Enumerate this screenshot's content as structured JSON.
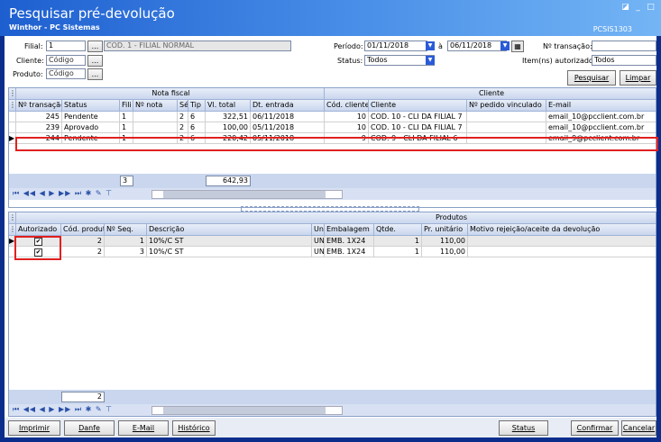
{
  "window": {
    "title": "Pesquisar pré-devolução",
    "subtitle": "Winthor - PC Sistemas",
    "code": "PCSIS1303"
  },
  "filters": {
    "filial_label": "Filial:",
    "filial_value": "1",
    "filial_desc": "COD. 1 - FILIAL NORMAL",
    "cliente_label": "Cliente:",
    "cliente_placeholder": "Código",
    "produto_label": "Produto:",
    "produto_placeholder": "Código",
    "periodo_label": "Período:",
    "periodo_start": "01/11/2018",
    "periodo_sep": "à",
    "periodo_end": "06/11/2018",
    "status_label": "Status:",
    "status_value": "Todos",
    "transacao_label": "Nº transação:",
    "transacao_value": "",
    "itens_label": "Item(ns) autorizado:",
    "itens_value": "Todos",
    "ellipsis": "..."
  },
  "actions": {
    "pesquisar": "Pesquisar",
    "limpar": "Limpar"
  },
  "grid1": {
    "group_nota": "Nota fiscal",
    "group_cliente": "Cliente",
    "headers": [
      "Nº transação",
      "Status",
      "Fili",
      "Nº nota",
      "Sér",
      "Tip",
      "Vl. total",
      "Dt. entrada",
      "Cód. cliente",
      "Cliente",
      "Nº pedido vinculado",
      "E-mail"
    ],
    "rows": [
      [
        "245",
        "Pendente",
        "1",
        "",
        "2",
        "6",
        "322,51",
        "06/11/2018",
        "10",
        "COD. 10 - CLI DA FILIAL 7",
        "",
        "email_10@pcclient.com.br"
      ],
      [
        "239",
        "Aprovado",
        "1",
        "",
        "2",
        "6",
        "100,00",
        "05/11/2018",
        "10",
        "COD. 10 - CLI DA FILIAL 7",
        "",
        "email_10@pcclient.com.br"
      ],
      [
        "244",
        "Pendente",
        "1",
        "",
        "2",
        "6",
        "220,42",
        "05/11/2018",
        "9",
        "COD. 9 - CLI DA FILIAL 6",
        "",
        "email_9@pcclient.com.br"
      ]
    ],
    "footer_count": "3",
    "footer_total": "642,93"
  },
  "grid2": {
    "group": "Produtos",
    "headers": [
      "Autorizado",
      "Cód. produt",
      "Nº Seq.",
      "Descrição",
      "Uni",
      "Embalagem",
      "Qtde.",
      "Pr. unitário",
      "Motivo rejeição/aceite da devolução"
    ],
    "rows": [
      [
        "✔",
        "2",
        "1",
        "10%/C ST",
        "UN",
        "EMB. 1X24",
        "1",
        "110,00",
        ""
      ],
      [
        "✔",
        "2",
        "3",
        "10%/C ST",
        "UN",
        "EMB. 1X24",
        "1",
        "110,00",
        ""
      ]
    ],
    "footer_count": "2"
  },
  "bottom": {
    "imprimir": "Imprimir",
    "danfe": "Danfe",
    "email": "E-Mail",
    "historico": "Histórico",
    "status": "Status",
    "confirmar": "Confirmar",
    "cancelar": "Cancelar"
  }
}
